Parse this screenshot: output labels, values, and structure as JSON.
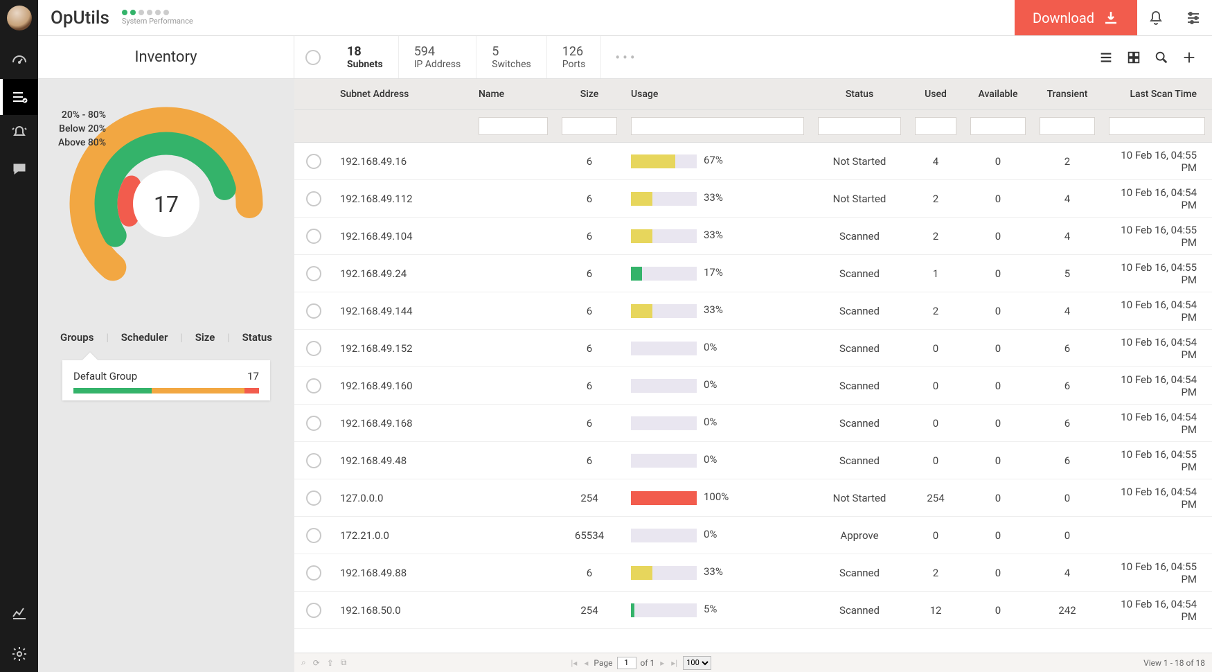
{
  "brand": "OpUtils",
  "system_perf_label": "System Performance",
  "download_label": "Download",
  "inventory_title": "Inventory",
  "metrics": [
    {
      "n": "18",
      "l": "Subnets",
      "active": true
    },
    {
      "n": "594",
      "l": "IP Address"
    },
    {
      "n": "5",
      "l": "Switches"
    },
    {
      "n": "126",
      "l": "Ports"
    }
  ],
  "legend": {
    "mid": "20% - 80%",
    "low": "Below 20%",
    "high": "Above 80%"
  },
  "donut_center": "17",
  "tabs": {
    "groups": "Groups",
    "scheduler": "Scheduler",
    "size": "Size",
    "status": "Status"
  },
  "group_card": {
    "name": "Default Group",
    "count": "17",
    "bar": {
      "g": 42,
      "o": 50,
      "r": 8
    }
  },
  "columns": {
    "addr": "Subnet Address",
    "name": "Name",
    "size": "Size",
    "usage": "Usage",
    "status": "Status",
    "used": "Used",
    "avail": "Available",
    "trans": "Transient",
    "scan": "Last Scan Time"
  },
  "rows": [
    {
      "addr": "192.168.49.16",
      "size": "6",
      "usage": 67,
      "color": "y",
      "status": "Not Started",
      "used": "4",
      "avail": "0",
      "trans": "2",
      "scan": "10 Feb 16, 04:55 PM"
    },
    {
      "addr": "192.168.49.112",
      "size": "6",
      "usage": 33,
      "color": "y",
      "status": "Not Started",
      "used": "2",
      "avail": "0",
      "trans": "4",
      "scan": "10 Feb 16, 04:54 PM"
    },
    {
      "addr": "192.168.49.104",
      "size": "6",
      "usage": 33,
      "color": "y",
      "status": "Scanned",
      "used": "2",
      "avail": "0",
      "trans": "4",
      "scan": "10 Feb 16, 04:55 PM"
    },
    {
      "addr": "192.168.49.24",
      "size": "6",
      "usage": 17,
      "color": "g",
      "status": "Scanned",
      "used": "1",
      "avail": "0",
      "trans": "5",
      "scan": "10 Feb 16, 04:55 PM"
    },
    {
      "addr": "192.168.49.144",
      "size": "6",
      "usage": 33,
      "color": "y",
      "status": "Scanned",
      "used": "2",
      "avail": "0",
      "trans": "4",
      "scan": "10 Feb 16, 04:54 PM"
    },
    {
      "addr": "192.168.49.152",
      "size": "6",
      "usage": 0,
      "color": "y",
      "status": "Scanned",
      "used": "0",
      "avail": "0",
      "trans": "6",
      "scan": "10 Feb 16, 04:54 PM"
    },
    {
      "addr": "192.168.49.160",
      "size": "6",
      "usage": 0,
      "color": "y",
      "status": "Scanned",
      "used": "0",
      "avail": "0",
      "trans": "6",
      "scan": "10 Feb 16, 04:54 PM"
    },
    {
      "addr": "192.168.49.168",
      "size": "6",
      "usage": 0,
      "color": "y",
      "status": "Scanned",
      "used": "0",
      "avail": "0",
      "trans": "6",
      "scan": "10 Feb 16, 04:54 PM"
    },
    {
      "addr": "192.168.49.48",
      "size": "6",
      "usage": 0,
      "color": "y",
      "status": "Scanned",
      "used": "0",
      "avail": "0",
      "trans": "6",
      "scan": "10 Feb 16, 04:55 PM"
    },
    {
      "addr": "127.0.0.0",
      "size": "254",
      "usage": 100,
      "color": "r",
      "status": "Not Started",
      "used": "254",
      "avail": "0",
      "trans": "0",
      "scan": "10 Feb 16, 04:54 PM"
    },
    {
      "addr": "172.21.0.0",
      "size": "65534",
      "usage": 0,
      "color": "y",
      "status": "Approve",
      "used": "0",
      "avail": "0",
      "trans": "0",
      "scan": ""
    },
    {
      "addr": "192.168.49.88",
      "size": "6",
      "usage": 33,
      "color": "y",
      "status": "Scanned",
      "used": "2",
      "avail": "0",
      "trans": "4",
      "scan": "10 Feb 16, 04:55 PM"
    },
    {
      "addr": "192.168.50.0",
      "size": "254",
      "usage": 5,
      "color": "g",
      "status": "Scanned",
      "used": "12",
      "avail": "0",
      "trans": "242",
      "scan": "10 Feb 16, 04:54 PM"
    }
  ],
  "footer": {
    "page_label": "Page",
    "page": "1",
    "of_label": "of 1",
    "per_page": "100",
    "view": "View 1 - 18 of 18"
  },
  "chart_data": {
    "type": "pie",
    "title": "Subnet usage distribution",
    "series": [
      {
        "name": "20% - 80%",
        "value": 11,
        "color": "#f2a742"
      },
      {
        "name": "Below 20%",
        "value": 5,
        "color": "#34b36a"
      },
      {
        "name": "Above 80%",
        "value": 1,
        "color": "#f25c4d"
      }
    ],
    "center_value": 17
  }
}
